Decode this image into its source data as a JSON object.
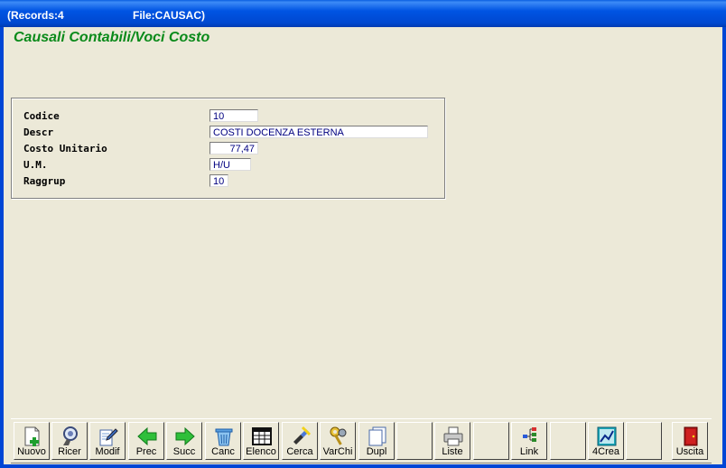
{
  "window": {
    "title_records": "(Records:4",
    "title_file": "File:CAUSAC)"
  },
  "form": {
    "title": "Causali Contabili/Voci Costo",
    "fields": {
      "codice": {
        "label": "Codice",
        "value": "10"
      },
      "descr": {
        "label": "Descr",
        "value": "COSTI DOCENZA ESTERNA"
      },
      "costo": {
        "label": "Costo Unitario",
        "value": "77,47"
      },
      "um": {
        "label": "U.M.",
        "value": "H/U"
      },
      "raggrup": {
        "label": "Raggrup",
        "value": "10"
      }
    }
  },
  "toolbar": {
    "nuovo": "Nuovo",
    "ricer": "Ricer",
    "modif": "Modif",
    "prec": "Prec",
    "succ": "Succ",
    "canc": "Canc",
    "elenco": "Elenco",
    "cerca": "Cerca",
    "varchi": "VarChi",
    "dupl": "Dupl",
    "liste": "Liste",
    "link": "Link",
    "crea": "4Crea",
    "uscita": "Uscita"
  },
  "colors": {
    "title_green": "#0a8a1a",
    "field_text": "#000080",
    "titlebar_blue": "#0054e3",
    "panel": "#ece9d8"
  }
}
